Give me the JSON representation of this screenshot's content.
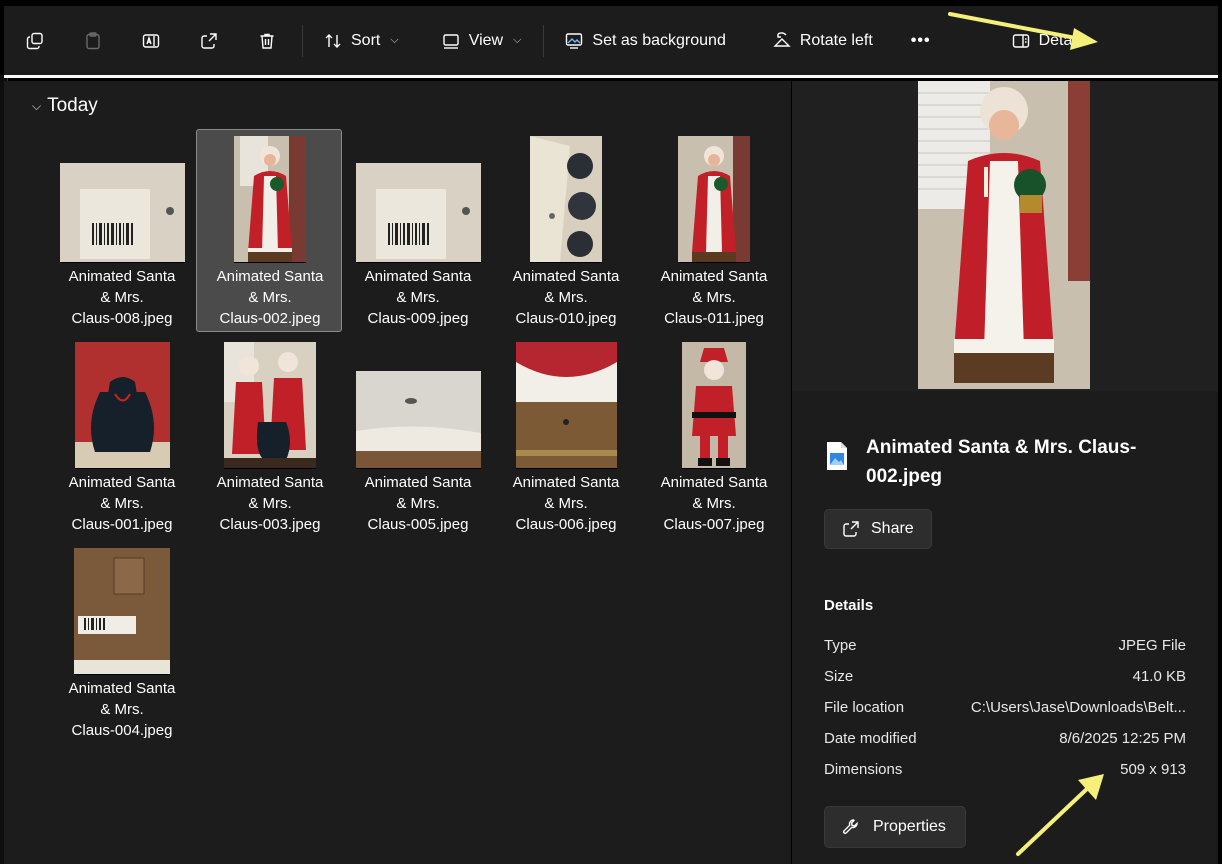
{
  "toolbar": {
    "icons": [
      "copy-icon",
      "paste-icon",
      "rename-icon",
      "share-icon",
      "delete-icon"
    ],
    "sort_label": "Sort",
    "view_label": "View",
    "set_background_label": "Set as background",
    "rotate_left_label": "Rotate left",
    "more_label": "•••",
    "details_label": "Details"
  },
  "group": {
    "label": "Today"
  },
  "files": [
    {
      "name": "Animated Santa & Mrs. Claus-008.jpeg",
      "line1": "Animated Santa",
      "line2": "& Mrs.",
      "line3": "Claus-008.jpeg"
    },
    {
      "name": "Animated Santa & Mrs. Claus-002.jpeg",
      "line1": "Animated Santa",
      "line2": "& Mrs.",
      "line3": "Claus-002.jpeg",
      "selected": true
    },
    {
      "name": "Animated Santa & Mrs. Claus-009.jpeg",
      "line1": "Animated Santa",
      "line2": "& Mrs.",
      "line3": "Claus-009.jpeg"
    },
    {
      "name": "Animated Santa & Mrs. Claus-010.jpeg",
      "line1": "Animated Santa",
      "line2": "& Mrs.",
      "line3": "Claus-010.jpeg"
    },
    {
      "name": "Animated Santa & Mrs. Claus-011.jpeg",
      "line1": "Animated Santa",
      "line2": "& Mrs.",
      "line3": "Claus-011.jpeg"
    },
    {
      "name": "Animated Santa & Mrs. Claus-001.jpeg",
      "line1": "Animated Santa",
      "line2": "& Mrs.",
      "line3": "Claus-001.jpeg"
    },
    {
      "name": "Animated Santa & Mrs. Claus-003.jpeg",
      "line1": "Animated Santa",
      "line2": "& Mrs.",
      "line3": "Claus-003.jpeg"
    },
    {
      "name": "Animated Santa & Mrs. Claus-005.jpeg",
      "line1": "Animated Santa",
      "line2": "& Mrs.",
      "line3": "Claus-005.jpeg"
    },
    {
      "name": "Animated Santa & Mrs. Claus-006.jpeg",
      "line1": "Animated Santa",
      "line2": "& Mrs.",
      "line3": "Claus-006.jpeg"
    },
    {
      "name": "Animated Santa & Mrs. Claus-007.jpeg",
      "line1": "Animated Santa",
      "line2": "& Mrs.",
      "line3": "Claus-007.jpeg"
    },
    {
      "name": "Animated Santa & Mrs. Claus-004.jpeg",
      "line1": "Animated Santa",
      "line2": "& Mrs.",
      "line3": "Claus-004.jpeg"
    }
  ],
  "details_pane": {
    "title": "Animated Santa & Mrs. Claus-002.jpeg",
    "share_label": "Share",
    "section_heading": "Details",
    "properties": [
      {
        "label": "Type",
        "value": "JPEG File"
      },
      {
        "label": "Size",
        "value": "41.0 KB"
      },
      {
        "label": "File location",
        "value": "C:\\Users\\Jase\\Downloads\\Belt..."
      },
      {
        "label": "Date modified",
        "value": "8/6/2025 12:25 PM"
      },
      {
        "label": "Dimensions",
        "value": "509 x 913"
      }
    ],
    "properties_button_label": "Properties"
  },
  "colors": {
    "annotation_arrow": "#f5f07a",
    "selection": "#4b4b4b"
  }
}
